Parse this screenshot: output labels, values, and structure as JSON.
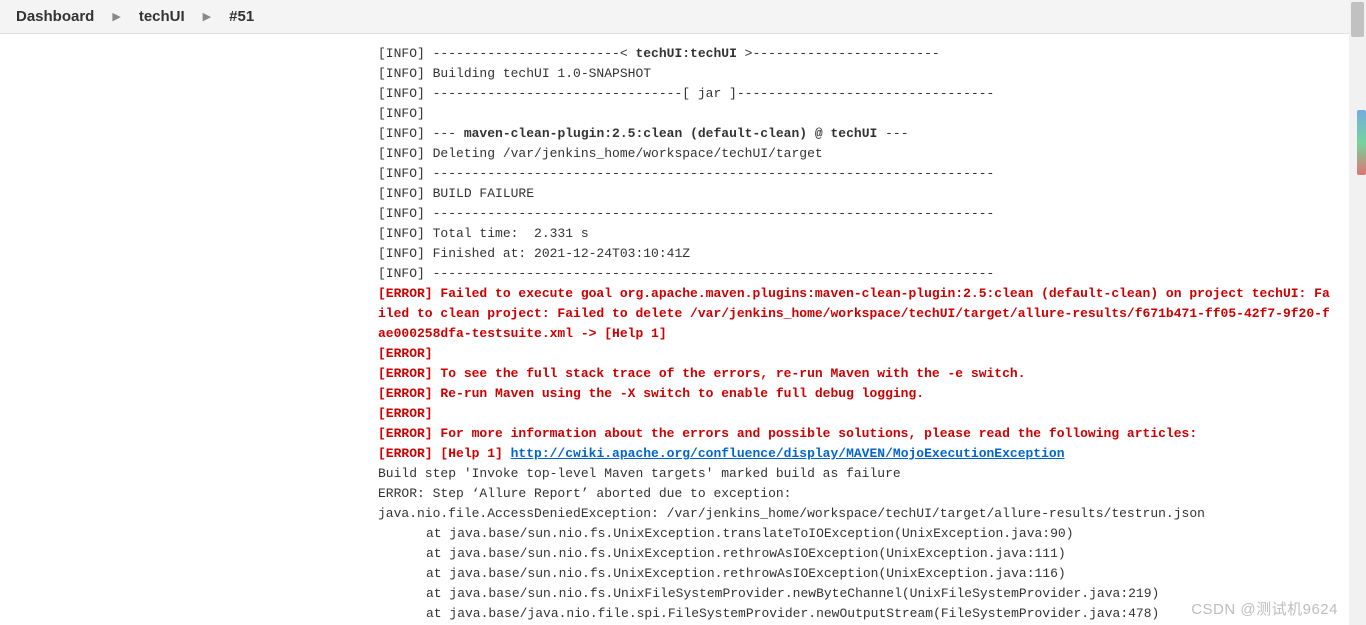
{
  "breadcrumb": {
    "dashboard": "Dashboard",
    "project": "techUI",
    "build": "#51"
  },
  "console": {
    "lines": [
      {
        "type": "info",
        "prefix": "[INFO] ",
        "text": "------------------------< ",
        "bold": "techUI:techUI",
        "suffix": " >------------------------"
      },
      {
        "type": "info",
        "prefix": "[INFO] ",
        "text": "Building techUI 1.0-SNAPSHOT"
      },
      {
        "type": "info",
        "prefix": "[INFO] ",
        "text": "--------------------------------[ jar ]---------------------------------"
      },
      {
        "type": "info",
        "prefix": "[INFO] ",
        "text": ""
      },
      {
        "type": "info-bold",
        "prefix": "[INFO] ",
        "text": "--- ",
        "bold": "maven-clean-plugin:2.5:clean (default-clean) @ techUI",
        "suffix": " ---"
      },
      {
        "type": "info",
        "prefix": "[INFO] ",
        "text": "Deleting /var/jenkins_home/workspace/techUI/target"
      },
      {
        "type": "info",
        "prefix": "[INFO] ",
        "text": "------------------------------------------------------------------------"
      },
      {
        "type": "info",
        "prefix": "[INFO] ",
        "text": "BUILD FAILURE"
      },
      {
        "type": "info",
        "prefix": "[INFO] ",
        "text": "------------------------------------------------------------------------"
      },
      {
        "type": "info",
        "prefix": "[INFO] ",
        "text": "Total time:  2.331 s"
      },
      {
        "type": "info",
        "prefix": "[INFO] ",
        "text": "Finished at: 2021-12-24T03:10:41Z"
      },
      {
        "type": "info",
        "prefix": "[INFO] ",
        "text": "------------------------------------------------------------------------"
      },
      {
        "type": "error",
        "text": "[ERROR] Failed to execute goal org.apache.maven.plugins:maven-clean-plugin:2.5:clean (default-clean) on project techUI: Failed to clean project: Failed to delete /var/jenkins_home/workspace/techUI/target/allure-results/f671b471-ff05-42f7-9f20-fae000258dfa-testsuite.xml -> [Help 1]"
      },
      {
        "type": "error",
        "text": "[ERROR]"
      },
      {
        "type": "error",
        "text": "[ERROR] To see the full stack trace of the errors, re-run Maven with the -e switch."
      },
      {
        "type": "error",
        "text": "[ERROR] Re-run Maven using the -X switch to enable full debug logging."
      },
      {
        "type": "error",
        "text": "[ERROR]"
      },
      {
        "type": "error",
        "text": "[ERROR] For more information about the errors and possible solutions, please read the following articles:"
      },
      {
        "type": "error-link",
        "prefix": "[ERROR] [Help 1] ",
        "link": "http://cwiki.apache.org/confluence/display/MAVEN/MojoExecutionException"
      },
      {
        "type": "plain",
        "text": "Build step 'Invoke top-level Maven targets' marked build as failure"
      },
      {
        "type": "plain",
        "text": "ERROR: Step ‘Allure Report’ aborted due to exception: "
      },
      {
        "type": "plain",
        "text": "java.nio.file.AccessDeniedException: /var/jenkins_home/workspace/techUI/target/allure-results/testrun.json"
      },
      {
        "type": "stack",
        "text": "at java.base/sun.nio.fs.UnixException.translateToIOException(UnixException.java:90)"
      },
      {
        "type": "stack",
        "text": "at java.base/sun.nio.fs.UnixException.rethrowAsIOException(UnixException.java:111)"
      },
      {
        "type": "stack",
        "text": "at java.base/sun.nio.fs.UnixException.rethrowAsIOException(UnixException.java:116)"
      },
      {
        "type": "stack",
        "text": "at java.base/sun.nio.fs.UnixFileSystemProvider.newByteChannel(UnixFileSystemProvider.java:219)"
      },
      {
        "type": "stack",
        "text": "at java.base/java.nio.file.spi.FileSystemProvider.newOutputStream(FileSystemProvider.java:478)"
      }
    ]
  },
  "watermark": "CSDN @测试机9624"
}
